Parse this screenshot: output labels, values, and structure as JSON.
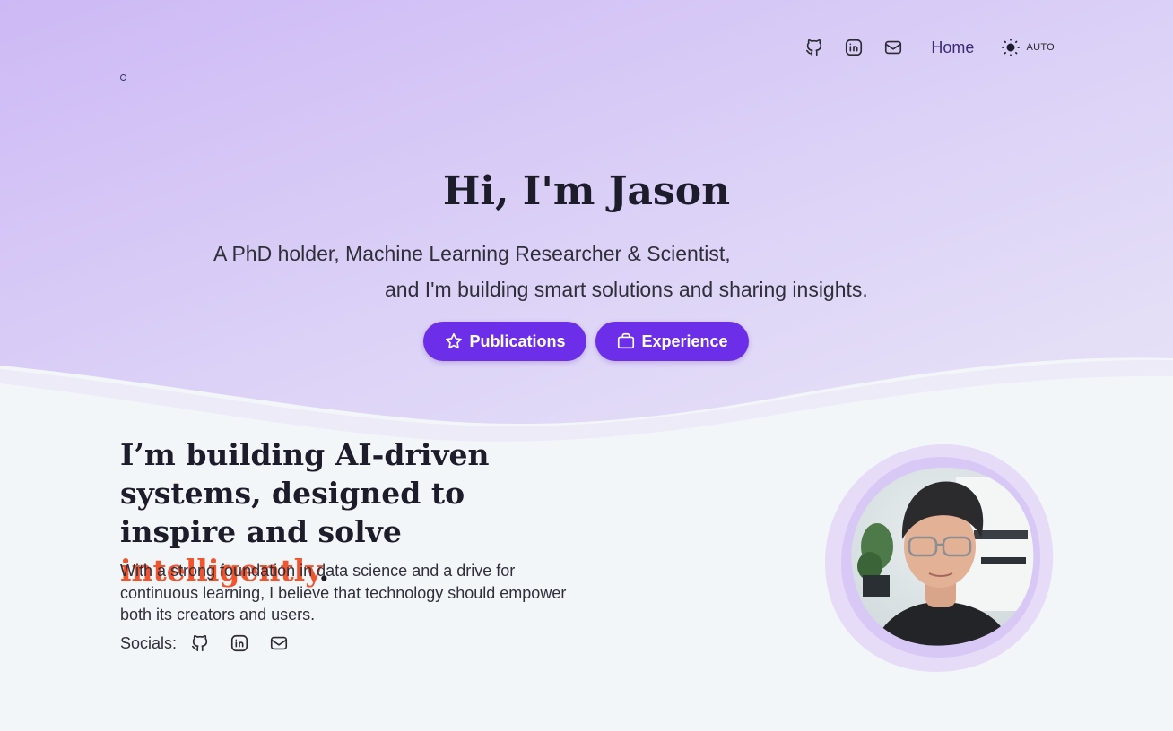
{
  "nav": {
    "home_label": "Home",
    "theme_label": "AUTO",
    "icons": [
      "github-icon",
      "linkedin-icon",
      "mail-icon",
      "sun-icon"
    ]
  },
  "hero": {
    "title": "Hi, I'm Jason",
    "line1": "A PhD holder, Machine Learning Researcher & Scientist,",
    "line2": "and I'm building smart solutions and sharing insights.",
    "buttons": {
      "publications": "Publications",
      "experience": "Experience"
    }
  },
  "about": {
    "headline_part1": "I’m building AI-driven systems, designed to inspire and solve ",
    "headline_accent": "intelligently",
    "headline_end": ".",
    "description": "With a strong foundation in data science and a drive for continuous learning, I believe that technology should empower both its creators and users.",
    "socials_label": "Socials:"
  },
  "colors": {
    "accent_purple": "#6c2ee8",
    "accent_orange": "#f2542d",
    "hero_bg_top": "#ddd3f6",
    "hero_bg_bottom": "#c9b6f3"
  }
}
